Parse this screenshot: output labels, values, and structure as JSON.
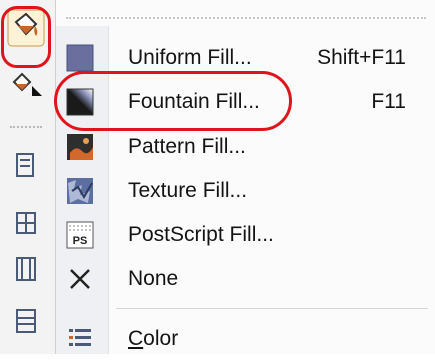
{
  "menu": {
    "items": [
      {
        "label": "Uniform Fill...",
        "shortcut": "Shift+F11",
        "icon": "uniform-fill-icon"
      },
      {
        "label": "Fountain Fill...",
        "shortcut": "F11",
        "icon": "fountain-fill-icon"
      },
      {
        "label": "Pattern Fill...",
        "shortcut": "",
        "icon": "pattern-fill-icon"
      },
      {
        "label": "Texture Fill...",
        "shortcut": "",
        "icon": "texture-fill-icon"
      },
      {
        "label": "PostScript Fill...",
        "shortcut": "",
        "icon": "postscript-fill-icon"
      },
      {
        "label": "None",
        "shortcut": "",
        "icon": "none-fill-icon"
      },
      {
        "label_rest": "olor",
        "label_accel": "C",
        "shortcut": "",
        "icon": "color-docker-icon"
      }
    ]
  },
  "toolbox": {
    "tools": [
      "fill-tool-icon",
      "interactive-fill-icon",
      "tool-a-icon",
      "tool-b-icon",
      "tool-c-icon",
      "tool-d-icon"
    ]
  },
  "colors": {
    "annotation": "#e0141b",
    "gutter": "#eef0f4",
    "uniform_fill": "#6b6f9e"
  }
}
